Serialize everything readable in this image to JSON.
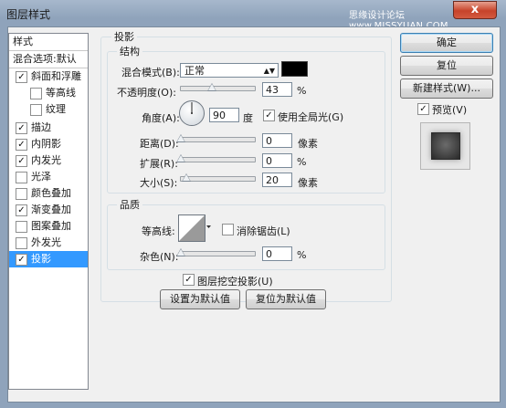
{
  "window": {
    "title": "图层样式",
    "watermark": "思缘设计论坛 www.MISSYUAN.COM",
    "close_label": "x"
  },
  "style_list": {
    "header": "样式",
    "blend_default": "混合选项:默认",
    "items": [
      {
        "label": "斜面和浮雕",
        "checked": true,
        "check": "✓",
        "sub": false,
        "selected": false
      },
      {
        "label": "等高线",
        "checked": false,
        "check": "",
        "sub": true,
        "selected": false
      },
      {
        "label": "纹理",
        "checked": false,
        "check": "",
        "sub": true,
        "selected": false
      },
      {
        "label": "描边",
        "checked": true,
        "check": "✓",
        "sub": false,
        "selected": false
      },
      {
        "label": "内阴影",
        "checked": true,
        "check": "✓",
        "sub": false,
        "selected": false
      },
      {
        "label": "内发光",
        "checked": true,
        "check": "✓",
        "sub": false,
        "selected": false
      },
      {
        "label": "光泽",
        "checked": false,
        "check": "",
        "sub": false,
        "selected": false
      },
      {
        "label": "颜色叠加",
        "checked": false,
        "check": "",
        "sub": false,
        "selected": false
      },
      {
        "label": "渐变叠加",
        "checked": true,
        "check": "✓",
        "sub": false,
        "selected": false
      },
      {
        "label": "图案叠加",
        "checked": false,
        "check": "",
        "sub": false,
        "selected": false
      },
      {
        "label": "外发光",
        "checked": false,
        "check": "",
        "sub": false,
        "selected": false
      },
      {
        "label": "投影",
        "checked": true,
        "check": "✓",
        "sub": false,
        "selected": true
      }
    ]
  },
  "drop_shadow": {
    "section_title": "投影",
    "structure": {
      "title": "结构",
      "blend_mode_label": "混合模式(B):",
      "blend_mode_value": "正常",
      "arrow": "▲▼",
      "color": "#000000",
      "opacity_label": "不透明度(O):",
      "opacity_value": "43",
      "opacity_unit": "%",
      "opacity_level": 0.43,
      "angle_label": "角度(A):",
      "angle_value": "90",
      "angle_unit": "度",
      "global_light_label": "使用全局光(G)",
      "global_light_check": "✓",
      "distance_label": "距离(D):",
      "distance_value": "0",
      "distance_unit": "像素",
      "distance_level": 0,
      "spread_label": "扩展(R):",
      "spread_value": "0",
      "spread_unit": "%",
      "spread_level": 0,
      "size_label": "大小(S):",
      "size_value": "20",
      "size_unit": "像素",
      "size_level": 0.08
    },
    "quality": {
      "title": "品质",
      "contour_label": "等高线:",
      "antialias_label": "消除锯齿(L)",
      "antialias_check": "",
      "noise_label": "杂色(N):",
      "noise_value": "0",
      "noise_unit": "%",
      "noise_level": 0
    },
    "knockout_label": "图层挖空投影(U)",
    "knockout_check": "✓",
    "make_default_label": "设置为默认值",
    "reset_default_label": "复位为默认值"
  },
  "buttons": {
    "ok": "确定",
    "reset": "复位",
    "new_style": "新建样式(W)...",
    "preview_label": "预览(V)",
    "preview_check": "✓"
  }
}
